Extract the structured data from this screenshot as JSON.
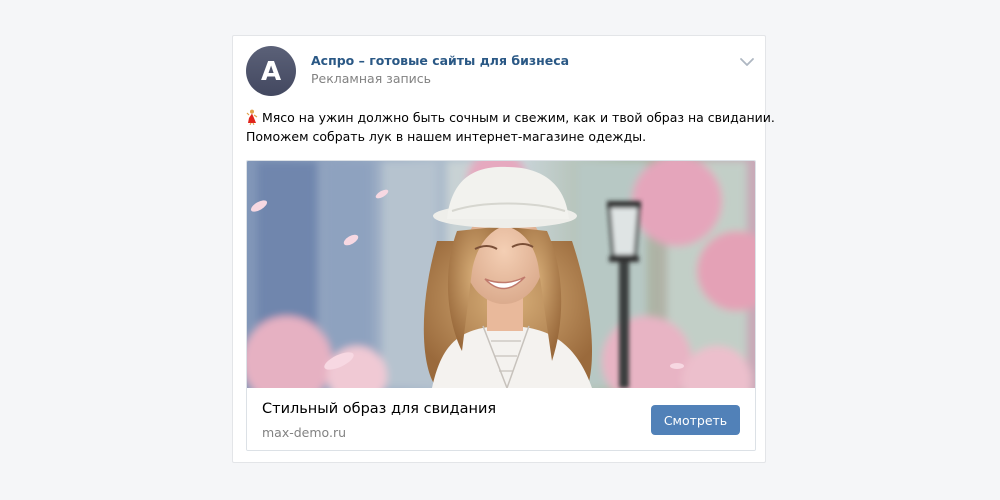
{
  "post": {
    "author": {
      "avatar_letter": "А",
      "name": "Аспро – готовые сайты для бизнеса",
      "meta": "Рекламная запись"
    },
    "menu_icon": "chevron-down-icon",
    "text_lines": [
      "Мясо на ужин должно быть сочным и свежим, как и твой образ на свидании.",
      "Поможем собрать лук в нашем интернет-магазине одежды."
    ],
    "emoji": "dancer-emoji-icon",
    "ad": {
      "image": "woman-in-white-hat-photo",
      "title": "Стильный образ для свидания",
      "domain": "max-demo.ru",
      "button_label": "Смотреть"
    }
  },
  "colors": {
    "page_background": "#f5f6f8",
    "link": "#2a5885",
    "meta_text": "#828282",
    "button": "#5181b8",
    "avatar": "#4d536b"
  }
}
